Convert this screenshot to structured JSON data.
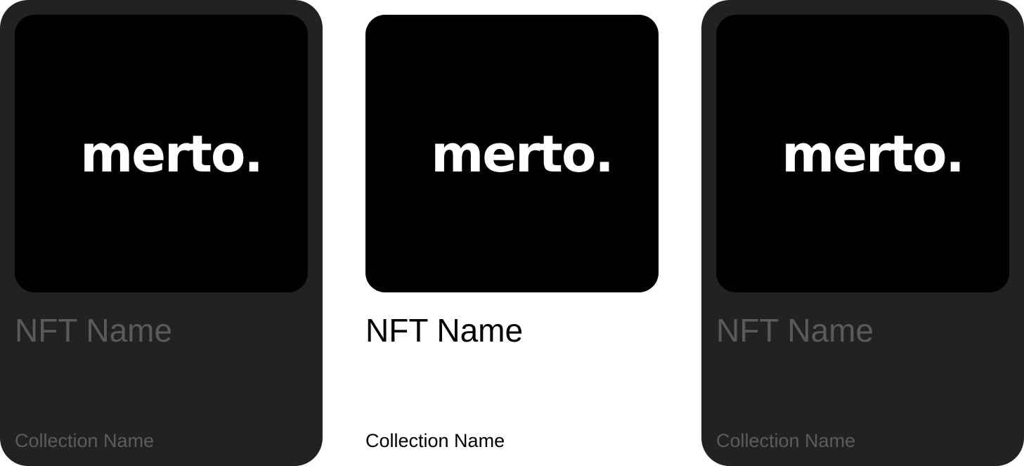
{
  "cards": [
    {
      "state": "dimmed",
      "logo_text": "merto.",
      "nft_name": "NFT Name",
      "collection_name": "Collection Name"
    },
    {
      "state": "active",
      "logo_text": "merto.",
      "nft_name": "NFT Name",
      "collection_name": "Collection Name"
    },
    {
      "state": "dimmed",
      "logo_text": "merto.",
      "nft_name": "NFT Name",
      "collection_name": "Collection Name"
    }
  ],
  "colors": {
    "card_background_dimmed": "#222222",
    "artwork_background": "#010101",
    "logo_text": "#ffffff",
    "dimmed_text": "#5a5a5a",
    "active_text": "#000000",
    "page_background": "#ffffff"
  }
}
